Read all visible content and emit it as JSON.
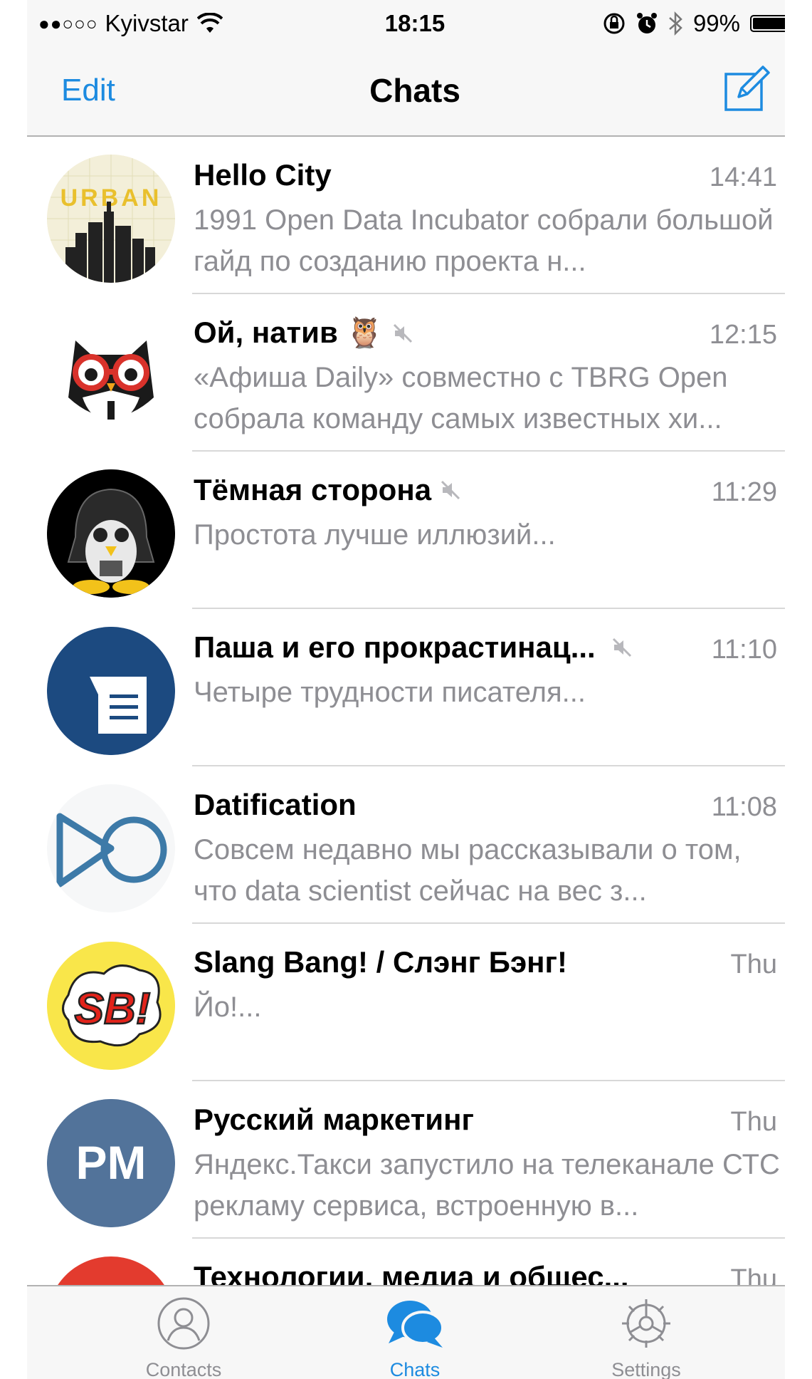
{
  "status_bar": {
    "signal_dots": "●●○○○",
    "carrier": "Kyivstar",
    "time": "18:15",
    "battery": "99%",
    "battery_level": 0.99
  },
  "nav": {
    "edit_label": "Edit",
    "title": "Chats"
  },
  "chats": [
    {
      "name": "Hello City",
      "time": "14:41",
      "preview": "1991 Open Data Incubator собрали большой гайд по созданию проекта н...",
      "muted": false
    },
    {
      "name": "Ой, натив 🦉",
      "time": "12:15",
      "preview": "«Афиша Daily» совместно с TBRG Open собрала команду самых известных хи...",
      "muted": true
    },
    {
      "name": "Тёмная сторона",
      "time": "11:29",
      "preview": "Простота лучше иллюзий...",
      "muted": true
    },
    {
      "name": "Паша и его прокрастинац...",
      "time": "11:10",
      "preview": "Четыре трудности писателя...",
      "muted": true
    },
    {
      "name": "Datification",
      "time": "11:08",
      "preview": "Совсем недавно мы рассказывали о том, что data scientist сейчас на вес з...",
      "muted": false
    },
    {
      "name": "Slang Bang! / Слэнг Бэнг!",
      "time": "Thu",
      "preview": "Йо!...",
      "muted": false
    },
    {
      "name": "Русский маркетинг",
      "time": "Thu",
      "preview": "Яндекс.Такси запустило на телеканале СТС рекламу сервиса, встроенную в...",
      "muted": false
    },
    {
      "name": "Технологии, медиа и общес...",
      "time": "Thu",
      "preview": "",
      "muted": false
    }
  ],
  "avatars": {
    "hello_city_text": "URBAN",
    "sb_text": "SB!",
    "pm_text": "PM"
  },
  "tabs": [
    {
      "label": "Contacts",
      "icon": "contacts-icon"
    },
    {
      "label": "Chats",
      "icon": "chats-icon"
    },
    {
      "label": "Settings",
      "icon": "settings-icon"
    }
  ],
  "colors": {
    "accent": "#1d8be0",
    "secondary_text": "#8e8e93",
    "bar_background": "#f7f7f7"
  }
}
